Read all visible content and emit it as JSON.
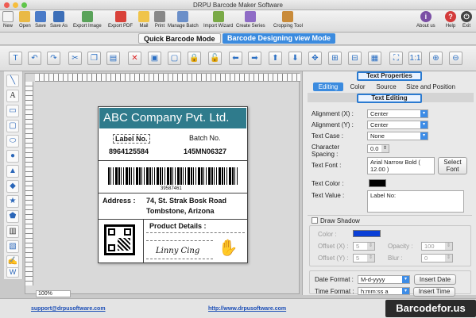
{
  "window": {
    "title": "DRPU Barcode Maker Software"
  },
  "toolbar": {
    "items": [
      "New",
      "Open",
      "Save",
      "Save As",
      "Export Image",
      "Export PDF",
      "Mail",
      "Print",
      "Manage Batch",
      "Import Wizard",
      "Create Series",
      "Cropping Tool"
    ],
    "right": [
      "About us",
      "Help",
      "Exit"
    ]
  },
  "modes": {
    "quick": "Quick Barcode Mode",
    "designing": "Barcode Designing view Mode"
  },
  "canvas": {
    "zoom": "100%"
  },
  "label": {
    "company": "ABC Company Pvt. Ltd.",
    "label_no_title": "Label No.",
    "label_no": "8964125584",
    "batch_no_title": "Batch No.",
    "batch_no": "145MN06327",
    "barcode_text": "39587461",
    "address_title": "Address :",
    "address_line1": "74, St. Strak Bosk Road",
    "address_line2": "Tombstone, Arizona",
    "product_details": "Product Details :",
    "signature": "Linny Cing"
  },
  "panel": {
    "header": "Text Properties",
    "tabs": [
      "Editing",
      "Color",
      "Source",
      "Size and Position"
    ],
    "subheader": "Text Editing",
    "alignment_x_label": "Alignment (X) :",
    "alignment_x": "Center",
    "alignment_y_label": "Alignment (Y) :",
    "alignment_y": "Center",
    "text_case_label": "Text Case :",
    "text_case": "None",
    "char_spacing_label": "Character Spacing :",
    "char_spacing": "0.0",
    "text_font_label": "Text Font :",
    "text_font": "Arial Narrow Bold ( 12.00 )",
    "select_font": "Select Font",
    "text_color_label": "Text Color :",
    "text_color": "#000000",
    "text_value_label": "Text Value :",
    "text_value": "Label No:",
    "draw_shadow": "Draw Shadow",
    "color_label": "Color :",
    "shadow_color": "#0a3fd6",
    "offset_x_label": "Offset (X) :",
    "offset_x": "5",
    "offset_y_label": "Offset (Y) :",
    "offset_y": "5",
    "opacity_label": "Opacity :",
    "opacity": "100",
    "blur_label": "Blur :",
    "blur": "0",
    "date_format_label": "Date Format :",
    "date_format": "M-d-yyyy",
    "insert_date": "Insert Date",
    "time_format_label": "Time Format :",
    "time_format": "h:mm:ss a",
    "insert_time": "Insert Time"
  },
  "footer": {
    "email": "support@drpusoftware.com",
    "url": "http://www.drpusoftware.com",
    "brand": "Barcodefor.us"
  }
}
